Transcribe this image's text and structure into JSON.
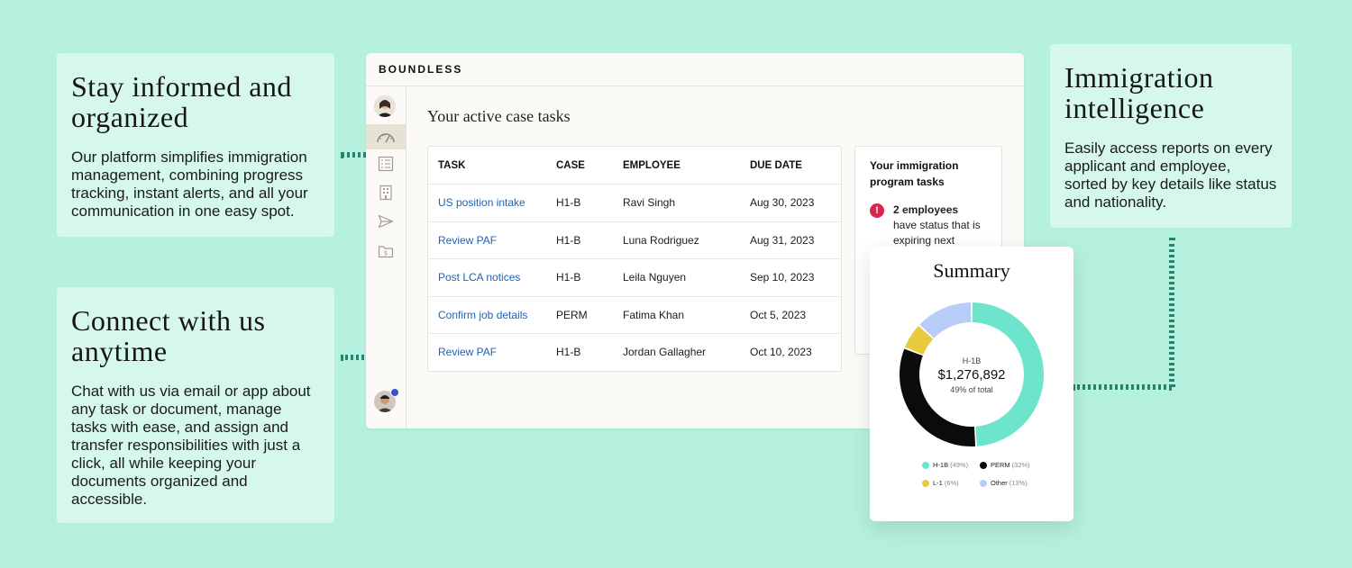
{
  "cards": {
    "stay": {
      "title": "Stay informed and organized",
      "body": "Our platform simplifies immigration management, combining progress tracking, instant alerts, and all your communication in one easy spot."
    },
    "connect": {
      "title": "Connect with us anytime",
      "body": "Chat with us via email or app about any task or document, manage tasks with ease, and assign and transfer responsibilities with just a click, all while keeping your documents organized and accessible."
    },
    "intel": {
      "title": "Immigration intelligence",
      "body": "Easily access reports on every applicant and employee, sorted by key details like status and nationality."
    }
  },
  "app": {
    "brand": "BOUNDLESS",
    "sidebar_icons": [
      "user-avatar",
      "dashboard-icon",
      "document-list-icon",
      "building-icon",
      "send-icon",
      "money-folder-icon"
    ],
    "main_title": "Your active case tasks",
    "table": {
      "headers": [
        "TASK",
        "CASE",
        "EMPLOYEE",
        "DUE DATE"
      ],
      "rows": [
        {
          "task": "US position intake",
          "case": "H1-B",
          "employee": "Ravi Singh",
          "due": "Aug 30, 2023"
        },
        {
          "task": "Review PAF",
          "case": "H1-B",
          "employee": "Luna Rodriguez",
          "due": "Aug 31, 2023"
        },
        {
          "task": "Post LCA notices",
          "case": "H1-B",
          "employee": "Leila Nguyen",
          "due": "Sep 10, 2023"
        },
        {
          "task": "Confirm job details",
          "case": "PERM",
          "employee": "Fatima Khan",
          "due": "Oct 5, 2023"
        },
        {
          "task": "Review PAF",
          "case": "H1-B",
          "employee": "Jordan Gallagher",
          "due": "Oct 10, 2023"
        }
      ]
    },
    "program": {
      "title": "Your immigration program tasks",
      "alert_icon": "!",
      "alert_bold": "2 employees",
      "alert_rest": "have status that is expiring next"
    }
  },
  "summary": {
    "title": "Summary",
    "center_label": "H-1B",
    "center_value": "$1,276,892",
    "center_sub": "49% of total"
  },
  "chart_data": {
    "type": "pie",
    "categories": [
      "H-1B",
      "PERM",
      "L-1",
      "Other"
    ],
    "values": [
      49,
      32,
      6,
      13
    ],
    "colors": [
      "#6ce5cc",
      "#0b0b0b",
      "#e9c93f",
      "#b7cdf7"
    ],
    "legend": [
      {
        "label": "H-1B",
        "pct": "(49%)"
      },
      {
        "label": "PERM",
        "pct": "(32%)"
      },
      {
        "label": "L-1",
        "pct": "(6%)"
      },
      {
        "label": "Other",
        "pct": "(13%)"
      }
    ]
  },
  "colors": {
    "background": "#b5f1de",
    "card": "#d6f8ec",
    "link": "#1f62b8",
    "alert": "#d9264d"
  }
}
